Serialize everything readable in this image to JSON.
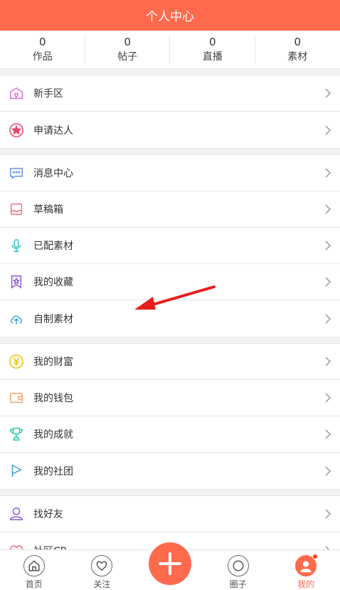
{
  "header": {
    "title": "个人中心"
  },
  "stats": [
    {
      "num": "0",
      "label": "作品"
    },
    {
      "num": "0",
      "label": "帖子"
    },
    {
      "num": "0",
      "label": "直播"
    },
    {
      "num": "0",
      "label": "素材"
    }
  ],
  "groups": [
    [
      {
        "label": "新手区",
        "icon": "gift-house-icon",
        "color": "#e06bd6"
      },
      {
        "label": "申请达人",
        "icon": "star-badge-icon",
        "color": "#e8456b"
      }
    ],
    [
      {
        "label": "消息中心",
        "icon": "chat-bubble-icon",
        "color": "#6a8fe6"
      },
      {
        "label": "草稿箱",
        "icon": "inbox-tray-icon",
        "color": "#ee6f7f"
      },
      {
        "label": "已配素材",
        "icon": "microphone-icon",
        "color": "#2ec4c4"
      },
      {
        "label": "我的收藏",
        "icon": "bookmark-star-icon",
        "color": "#8c5ad6"
      },
      {
        "label": "自制素材",
        "icon": "cloud-upload-icon",
        "color": "#3aa0e0"
      }
    ],
    [
      {
        "label": "我的财富",
        "icon": "yen-coin-icon",
        "color": "#f0c000"
      },
      {
        "label": "我的钱包",
        "icon": "wallet-icon",
        "color": "#f4a264"
      },
      {
        "label": "我的成就",
        "icon": "trophy-icon",
        "color": "#28c8a0"
      },
      {
        "label": "我的社团",
        "icon": "flag-icon",
        "color": "#3aa0e0"
      }
    ],
    [
      {
        "label": "找好友",
        "icon": "person-icon",
        "color": "#8c5ad6"
      },
      {
        "label": "社区CP",
        "icon": "heart-icon",
        "color": "#ee6f7f"
      }
    ]
  ],
  "tabbar": [
    {
      "label": "首页",
      "icon": "home-icon"
    },
    {
      "label": "关注",
      "icon": "heart-icon"
    },
    {
      "label": "",
      "icon": "plus-icon"
    },
    {
      "label": "圈子",
      "icon": "circle-icon"
    },
    {
      "label": "我的",
      "icon": "avatar-icon"
    }
  ],
  "colors": {
    "accent": "#ff6a4d"
  }
}
